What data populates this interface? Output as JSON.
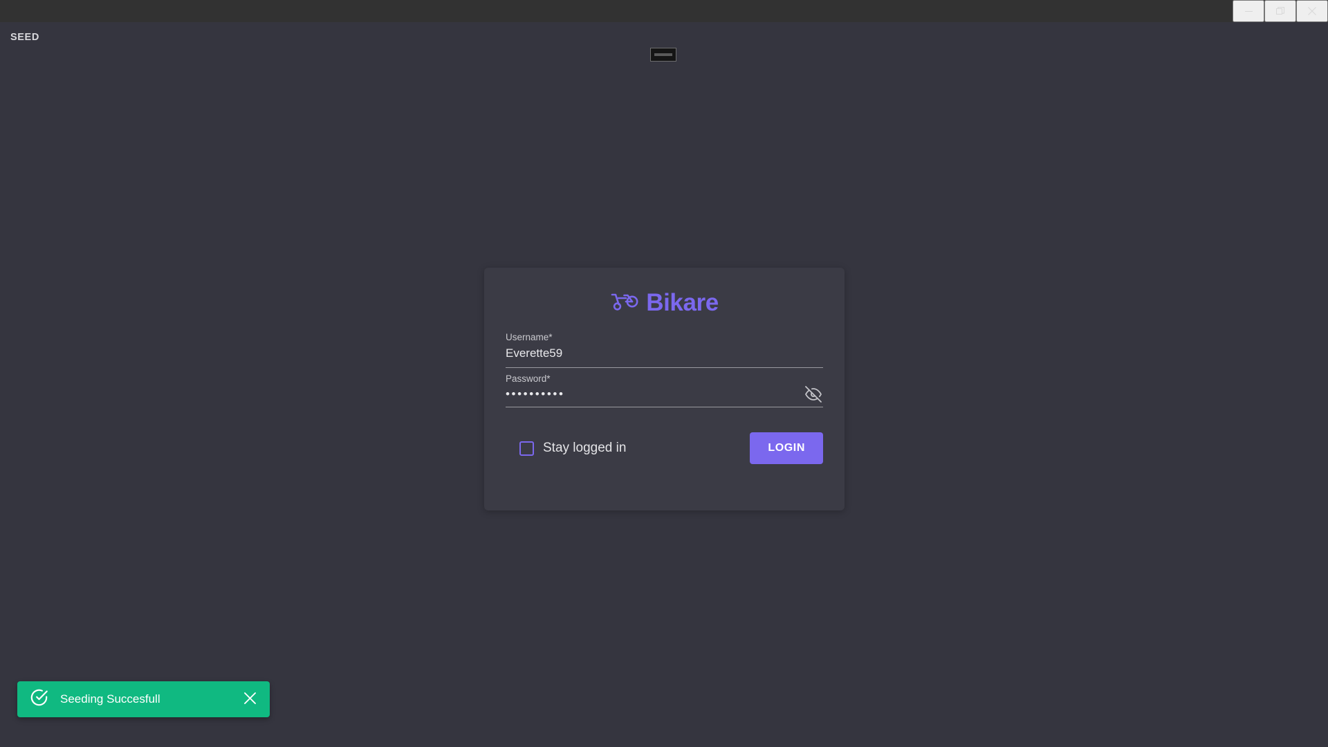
{
  "window": {
    "titlebar": {
      "minimize_label": "Minimize",
      "maximize_label": "Maximize",
      "close_label": "Close",
      "background_color": "#323232"
    }
  },
  "appbar": {
    "seed_label": "SEED",
    "top_indicator_label": ""
  },
  "login": {
    "brand_name": "Bikare",
    "brand_color": "#7b68ee",
    "logo_icon": "moped-icon",
    "username": {
      "label": "Username*",
      "value": "Everette59",
      "placeholder": ""
    },
    "password": {
      "label": "Password*",
      "value": "••••••••••",
      "placeholder": "",
      "visibility_icon": "eye-off-icon"
    },
    "stay_logged_in": {
      "label": "Stay logged in",
      "checked": false
    },
    "submit_label": "LOGIN",
    "card_color": "#3b3b45"
  },
  "toast": {
    "message": "Seeding Succesfull",
    "icon": "check-circle-icon",
    "close_icon": "close-icon",
    "background_color": "#10b981"
  },
  "theme": {
    "page_background": "#35353f",
    "accent": "#7b68ee"
  }
}
